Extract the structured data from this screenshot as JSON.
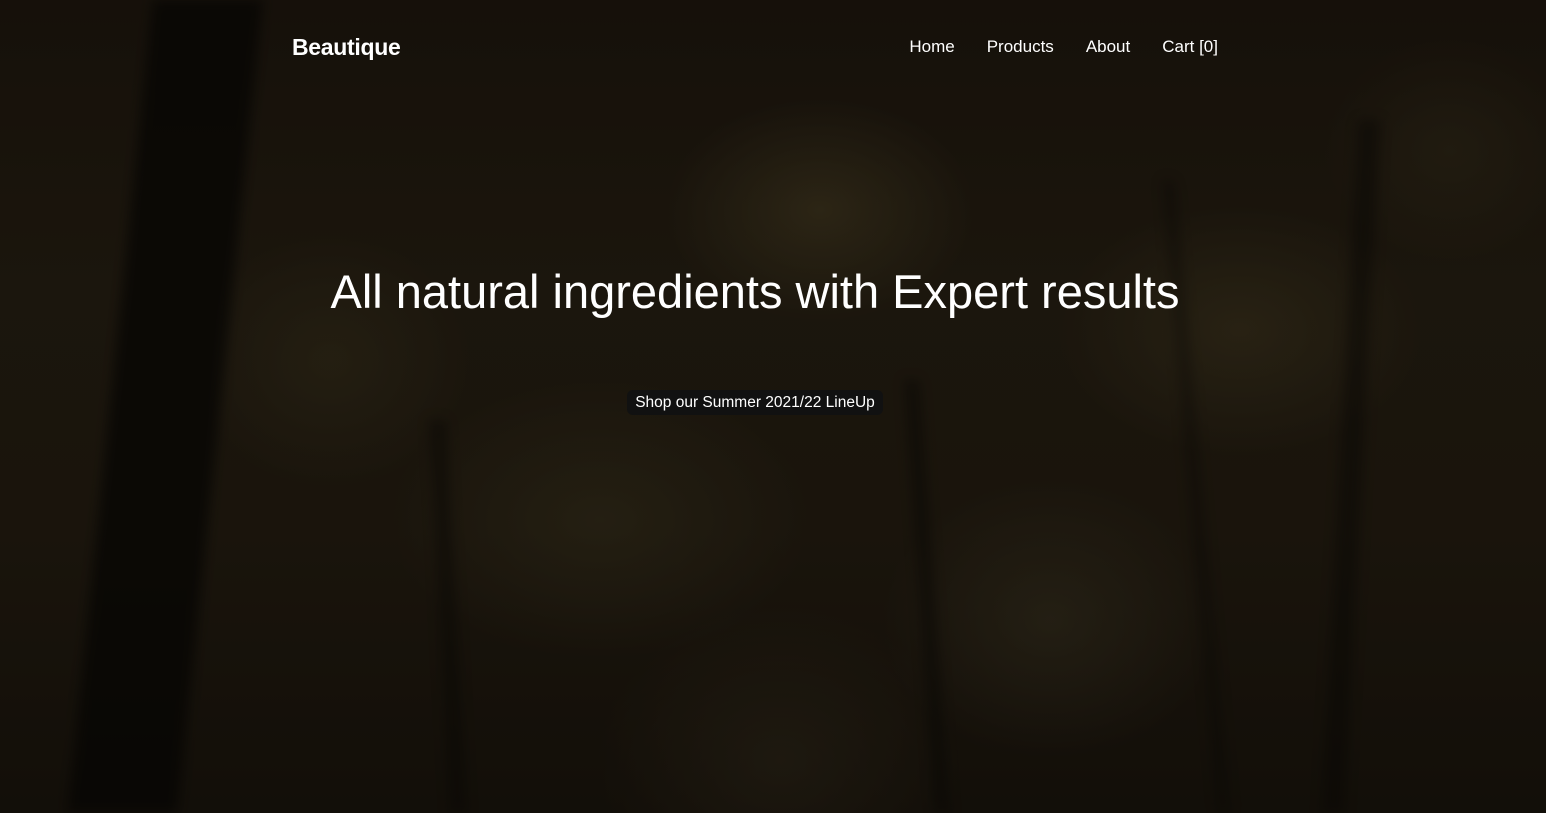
{
  "navbar": {
    "brand": "Beautique",
    "links": [
      {
        "label": "Home"
      },
      {
        "label": "Products"
      },
      {
        "label": "About"
      },
      {
        "label": "Cart [0]"
      }
    ]
  },
  "hero": {
    "headline": "All natural ingredients with Expert results",
    "cta_label": "Shop our Summer 2021/22 LineUp"
  },
  "colors": {
    "text": "#ffffff",
    "button_bg": "#111111",
    "background": "#1e170d"
  }
}
